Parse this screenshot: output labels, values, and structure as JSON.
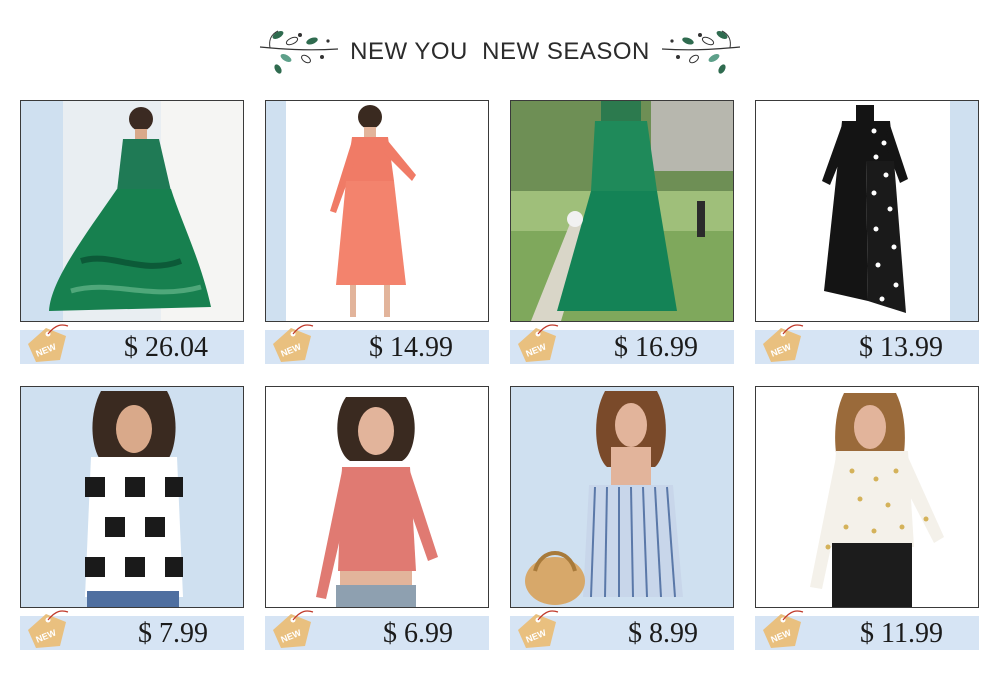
{
  "header": {
    "title": "NEW YOU  NEW SEASON",
    "left_ornament_icon": "leaf-sprig-icon",
    "right_ornament_icon": "leaf-sprig-icon"
  },
  "tag_label": "NEW",
  "colors": {
    "price_bar": "#d6e4f4",
    "tag": "#e9c07f",
    "leaf": "#2f6b4f"
  },
  "products": [
    {
      "price": "$ 26.04",
      "item": "tropical-print-maxi-dress"
    },
    {
      "price": "$ 14.99",
      "item": "coral-tie-neck-dress"
    },
    {
      "price": "$ 16.99",
      "item": "green-print-maxi-dress"
    },
    {
      "price": "$ 13.99",
      "item": "black-polka-dot-dress"
    },
    {
      "price": "$ 7.99",
      "item": "plaid-shirt"
    },
    {
      "price": "$ 6.99",
      "item": "pink-ribbed-crop-top"
    },
    {
      "price": "$ 8.99",
      "item": "striped-off-shoulder-dress"
    },
    {
      "price": "$ 11.99",
      "item": "dot-print-blouse"
    }
  ]
}
